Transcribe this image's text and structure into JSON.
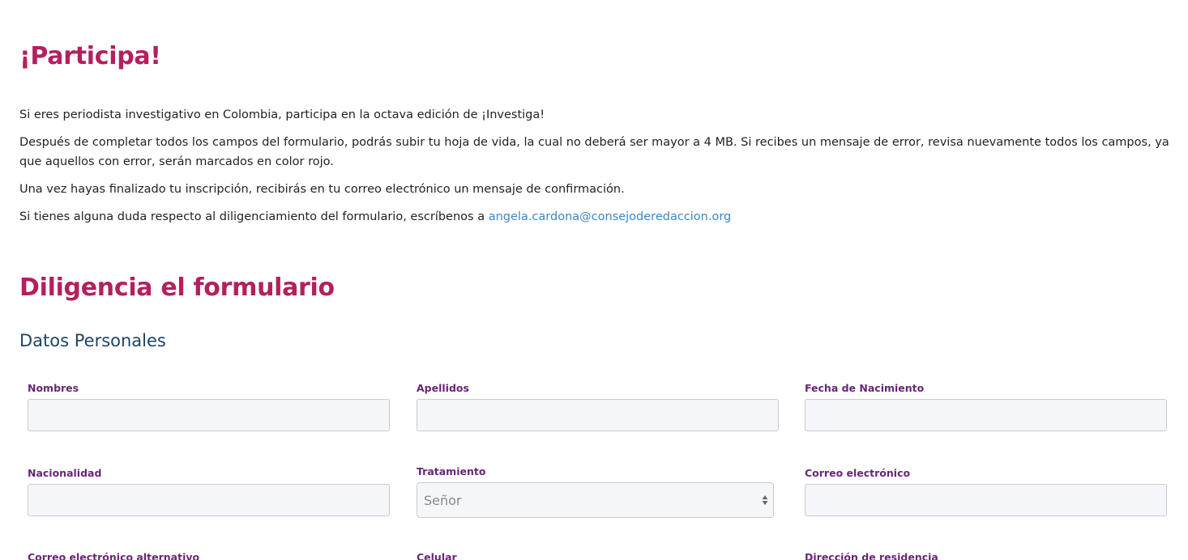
{
  "participa": {
    "title": "¡Participa!",
    "paragraph_1": "Si eres periodista investigativo en Colombia, participa en la octava edición de ¡Investiga!",
    "paragraph_2": "Después de completar todos los campos del formulario, podrás subir tu hoja de vida, la cual no deberá ser mayor a 4 MB. Si recibes un mensaje de error, revisa nuevamente todos los campos, ya que aquellos con error, serán marcados en color rojo.",
    "paragraph_3": "Una vez hayas finalizado tu inscripción, recibirás en tu correo electrónico un mensaje de confirmación.",
    "paragraph_4_prefix": "Si tienes alguna duda respecto al diligenciamiento del formulario, escríbenos a",
    "contact_email": "angela.cardona@consejoderedaccion.org"
  },
  "form": {
    "title": "Diligencia el formulario",
    "section_title": "Datos Personales",
    "fields": {
      "nombres": {
        "label": "Nombres",
        "value": ""
      },
      "apellidos": {
        "label": "Apellidos",
        "value": ""
      },
      "fecha_nacimiento": {
        "label": "Fecha de Nacimiento",
        "value": ""
      },
      "nacionalidad": {
        "label": "Nacionalidad",
        "value": ""
      },
      "tratamiento": {
        "label": "Tratamiento",
        "selected": "Señor"
      },
      "correo": {
        "label": "Correo electrónico",
        "value": ""
      },
      "correo_alternativo": {
        "label": "Correo electrónico alternativo"
      },
      "celular": {
        "label": "Celular"
      },
      "direccion": {
        "label": "Dirección de residencia"
      }
    }
  },
  "colors": {
    "heading": "#b41f5f",
    "section_heading": "#1e4462",
    "label": "#6a2577",
    "link": "#3a86c6",
    "input_bg": "#f5f6fa"
  },
  "icons": {
    "select_arrows": "select-arrows-icon"
  }
}
